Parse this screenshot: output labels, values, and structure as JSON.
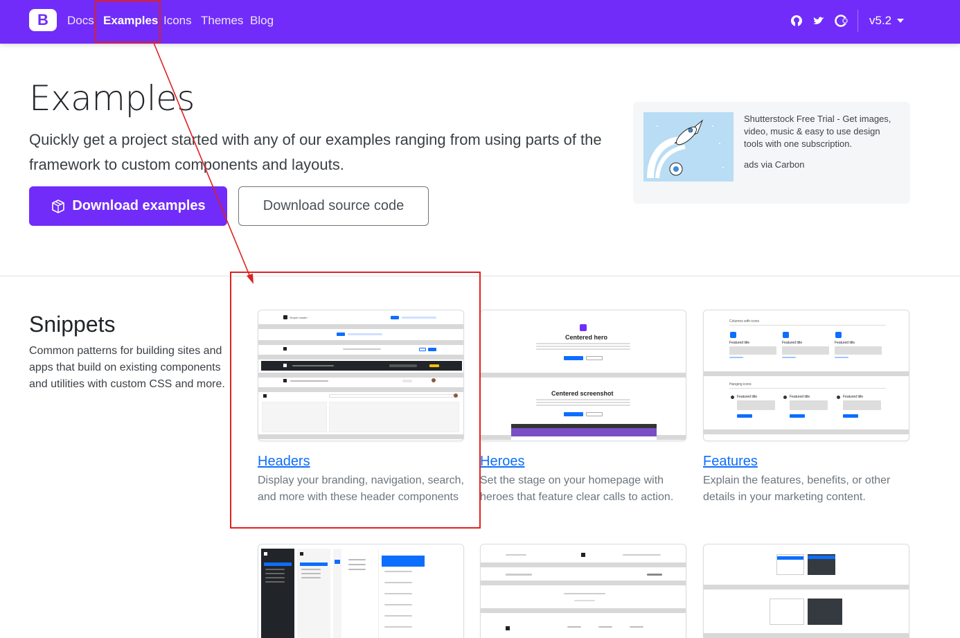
{
  "navbar": {
    "brand_letter": "B",
    "links": [
      "Docs",
      "Examples",
      "Icons",
      "Themes",
      "Blog"
    ],
    "active": "Examples",
    "icons": [
      "github-icon",
      "twitter-icon",
      "opencollective-icon"
    ],
    "version": "v5.2"
  },
  "hero": {
    "title": "Examples",
    "lead": "Quickly get a project started with any of our examples ranging from using parts of the framework to custom components and layouts.",
    "primary_button": "Download examples",
    "secondary_button": "Download source code"
  },
  "ad": {
    "text": "Shutterstock Free Trial - Get images, video, music & easy to use design tools with one subscription.",
    "via": "ads via Carbon"
  },
  "snippets": {
    "title": "Snippets",
    "description": "Common patterns for building sites and apps that build on existing components and utilities with custom CSS and more.",
    "cards": [
      {
        "title": "Headers",
        "description": "Display your branding, navigation, search, and more with these header components"
      },
      {
        "title": "Heroes",
        "description": "Set the stage on your homepage with heroes that feature clear calls to action."
      },
      {
        "title": "Features",
        "description": "Explain the features, benefits, or other details in your marketing content."
      }
    ],
    "thumb_text": {
      "simple_header": "Simple header",
      "centered_hero": "Centered hero",
      "centered_screenshot": "Centered screenshot",
      "columns_with_icons": "Columns with icons",
      "hanging_icons": "Hanging icons",
      "featured_title": "Featured title"
    }
  },
  "colors": {
    "brand": "#712cf9",
    "link": "#0d6efd",
    "annotation": "#e02020"
  }
}
